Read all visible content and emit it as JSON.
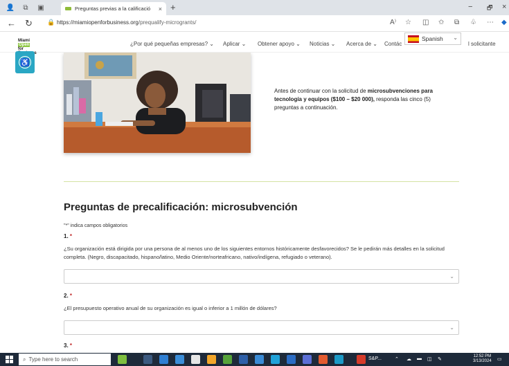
{
  "browser": {
    "tab_title": "Preguntas previas a la calificació",
    "tab_close": "×",
    "new_tab": "+",
    "url_domain": "https://miamiopenforbusiness.org",
    "url_path": "/prequalify-microgrants/",
    "read_aloud": "A⁾",
    "minimize": "−",
    "restore": "🗗",
    "close": "×"
  },
  "site": {
    "logo_top": "Miami",
    "logo_badge": "Open",
    "logo_bottom": "for Business",
    "nav": [
      "¿Por qué pequeñas empresas?",
      "Aplicar",
      "Obtener apoyo",
      "Noticias",
      "Acerca de",
      "Contác"
    ],
    "nav_cut": "l solicitante",
    "language": "Spanish"
  },
  "intro": {
    "prefix": "Antes de continuar con la solicitud de ",
    "bold1": "microsubvenciones para tecnología y equipos ($100 – $20 000),",
    "suffix": " responda las cinco (5) preguntas a continuación."
  },
  "form": {
    "title": "Preguntas de precalificación: microsubvención",
    "required_note": "\"*\" indica campos obligatorios",
    "required_mark": "*",
    "questions": [
      {
        "number": "1.",
        "text": "¿Su organización está dirigida por una persona de al menos uno de los siguientes entornos históricamente desfavorecidos? Se le pedirán más detalles en la solicitud completa. (Negro, discapacitado, hispano/latino, Medio Oriente/norteafricano, nativo/indígena, refugiado o veterano)."
      },
      {
        "number": "2.",
        "text": "¿El presupuesto operativo anual de su organización es igual o inferior a 1 millón de dólares?"
      },
      {
        "number": "3.",
        "text": ""
      }
    ]
  },
  "taskbar": {
    "search_placeholder": "Type here to search",
    "app_label": "S&P...",
    "time": "12:52 PM",
    "date": "3/13/2024"
  },
  "colors": {
    "accent_green": "#8cc63f",
    "a11y_blue": "#2aa7c4",
    "required_red": "#c02b2b",
    "divider": "#d4e2a2"
  }
}
